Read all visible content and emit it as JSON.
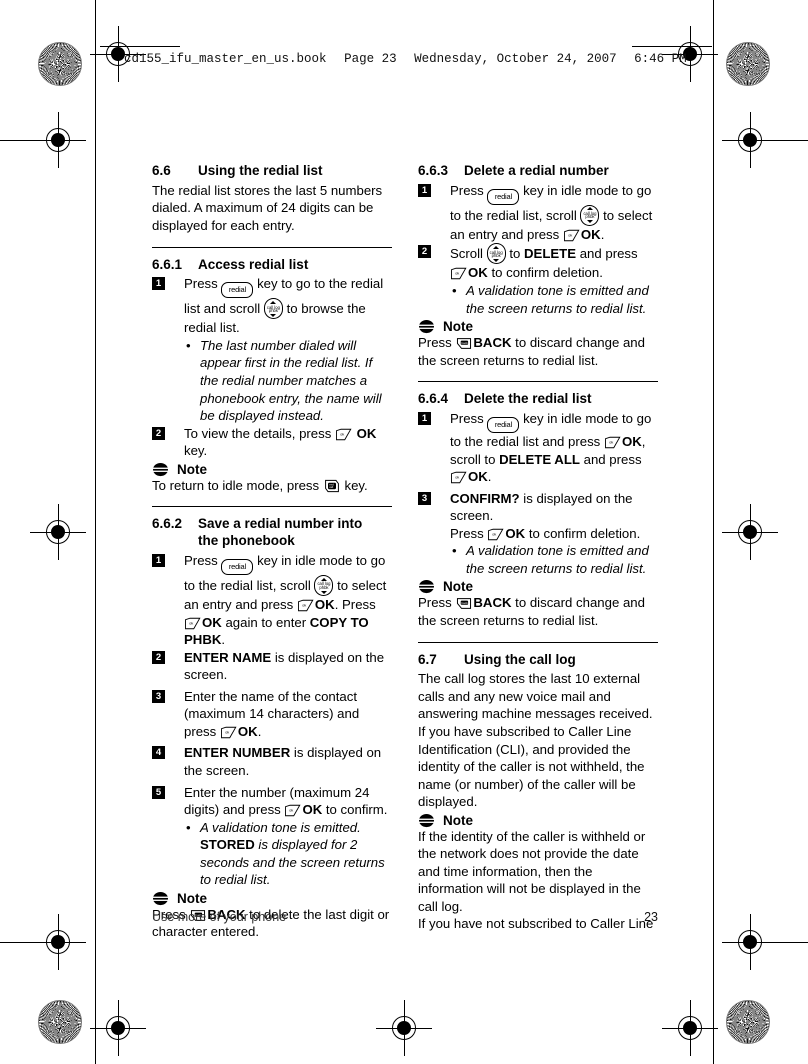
{
  "header_slug": {
    "filename": "cd155_ifu_master_en_us.book",
    "page": "Page 23",
    "weekday_date": "Wednesday, October 24, 2007",
    "time": "6:46 PM"
  },
  "footer": {
    "running_title": "Use more of your phone",
    "page_number": "23"
  },
  "icons": {
    "redial_key": "redial",
    "scroll_key_top": "call log",
    "scroll_key_bottom": "phbk",
    "ok_key": "ok",
    "back_key": "back",
    "end_key": "end"
  },
  "left_column": {
    "section_66": {
      "number": "6.6",
      "title": "Using the redial list",
      "intro": "The redial list stores the last 5 numbers dialed. A maximum of 24 digits can be displayed for each entry."
    },
    "section_661": {
      "number": "6.6.1",
      "title": "Access redial list",
      "step1": {
        "num": "1",
        "a": "Press",
        "b": "key to go to the redial list and scroll",
        "c": "to browse the redial list.",
        "bullet": "The last number dialed will appear first in the redial list. If the redial number matches a phonebook entry, the name will be displayed instead."
      },
      "step2": {
        "num": "2",
        "a": "To view the details, press",
        "bold": "OK",
        "c": "key."
      },
      "note": {
        "label": "Note",
        "a": "To return to idle mode, press",
        "c": "key."
      }
    },
    "section_662": {
      "number": "6.6.2",
      "title_line1": "Save a redial number into",
      "title_line2": "the phonebook",
      "step1": {
        "num": "1",
        "a": "Press",
        "b": "key in idle mode to go to the redial list, scroll",
        "c": "to select an entry and press",
        "ok1": "OK",
        "d": ". Press",
        "ok2": "OK",
        "e": "again to enter",
        "bold_end": "COPY TO PHBK",
        "f": "."
      },
      "step2": {
        "num": "2",
        "bold": "ENTER NAME",
        "rest": "is displayed on the screen."
      },
      "step3": {
        "num": "3",
        "a": "Enter the name of the contact (maximum 14 characters) and press",
        "ok": "OK",
        "c": "."
      },
      "step4": {
        "num": "4",
        "bold": "ENTER NUMBER",
        "rest": "is displayed on the screen."
      },
      "step5": {
        "num": "5",
        "a": "Enter the number (maximum 24 digits) and press",
        "ok": "OK",
        "c": "to confirm.",
        "bullet_a": "A validation tone is emitted.",
        "bullet_bold": "STORED",
        "bullet_b": "is displayed for 2 seconds and the screen returns to redial list."
      },
      "note": {
        "label": "Note",
        "a": "Press",
        "bold": "BACK",
        "c": "to delete the last digit or character entered."
      }
    }
  },
  "right_column": {
    "section_663": {
      "number": "6.6.3",
      "title": "Delete a redial number",
      "step1": {
        "num": "1",
        "a": "Press",
        "b": "key in idle mode to go to the redial list, scroll",
        "c": "to select an entry and press",
        "ok": "OK",
        "d": "."
      },
      "step2": {
        "num": "2",
        "a": "Scroll",
        "b": "to",
        "bold1": "DELETE",
        "c": "and press",
        "ok": "OK",
        "d": "to confirm deletion.",
        "bullet": "A validation tone is emitted and the screen returns to redial list."
      },
      "note": {
        "label": "Note",
        "a": "Press",
        "bold": "BACK",
        "c": "to discard change and the screen returns to redial list."
      }
    },
    "section_664": {
      "number": "6.6.4",
      "title": "Delete the redial list",
      "step1": {
        "num": "1",
        "a": "Press",
        "b": "key in idle mode to go to the redial list and press",
        "ok1": "OK",
        "c": ", scroll to",
        "bold1": "DELETE ALL",
        "d": "and press",
        "ok2": "OK",
        "e": "."
      },
      "step3": {
        "num": "3",
        "bold": "CONFIRM?",
        "a": "is displayed on the screen.",
        "b": "Press",
        "ok": "OK",
        "c": "to confirm deletion.",
        "bullet": "A validation tone is emitted and the screen returns to redial list."
      },
      "note": {
        "label": "Note",
        "a": "Press",
        "bold": "BACK",
        "c": "to discard change and the screen returns to redial list."
      }
    },
    "section_67": {
      "number": "6.7",
      "title": "Using the call log",
      "intro": "The call log stores the last 10 external calls and any new voice mail and answering machine messages received. If you have subscribed to Caller Line Identification (CLI), and provided the identity of the caller is not withheld, the name (or number) of the caller will be displayed.",
      "note": {
        "label": "Note",
        "para1": "If the identity of the caller is withheld or the network does not provide the date and time information, then the information will not be displayed in the call log.",
        "para2": "If you have not subscribed to Caller Line"
      }
    }
  }
}
